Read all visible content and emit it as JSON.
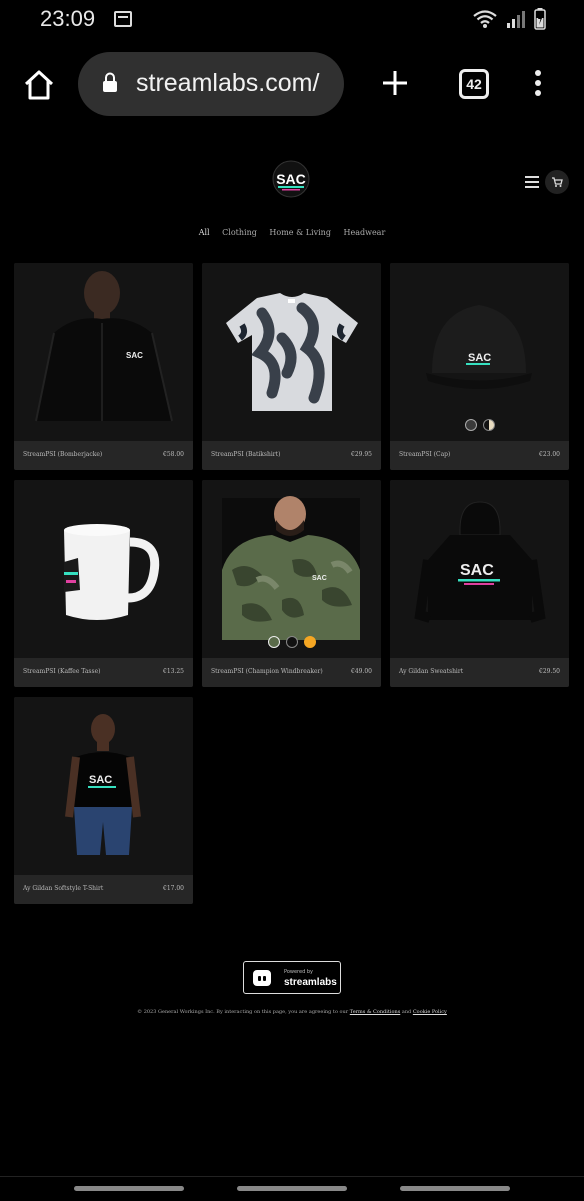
{
  "status_bar": {
    "time": "23:09"
  },
  "browser": {
    "url": "streamlabs.com/",
    "tab_count": "42"
  },
  "store": {
    "categories": [
      "All",
      "Clothing",
      "Home & Living",
      "Headwear"
    ],
    "products": [
      {
        "name": "StreamPSI (Bomberjacke)",
        "price": "€58.00",
        "icon": "bomber-jacket"
      },
      {
        "name": "StreamPSI (Batikshirt)",
        "price": "€29.95",
        "icon": "tie-dye-tshirt"
      },
      {
        "name": "StreamPSI (Cap)",
        "price": "€23.00",
        "icon": "snapback-cap"
      },
      {
        "name": "StreamPSI (Kaffee Tasse)",
        "price": "€13.25",
        "icon": "coffee-mug"
      },
      {
        "name": "StreamPSI (Champion Windbreaker)",
        "price": "€49.00",
        "icon": "camo-windbreaker"
      },
      {
        "name": "Ay Gildan Sweatshirt",
        "price": "€29.50",
        "icon": "hoodie"
      },
      {
        "name": "Ay Gildan Softstyle T-Shirt",
        "price": "€17.00",
        "icon": "tshirt"
      }
    ],
    "cap_swatches": [
      "#3a3a3a",
      "#e8dcc0"
    ],
    "windbreaker_swatches": [
      "#5a6b4a",
      "#111111",
      "#f5a623"
    ]
  },
  "footer": {
    "powered_small": "Powered by",
    "powered_brand": "streamlabs",
    "legal_prefix": "© 2023 General Workings Inc. By interacting on this page, you are agreeing to our",
    "terms_link": "Terms & Conditions",
    "and": "and",
    "cookie_link": "Cookie Policy"
  }
}
